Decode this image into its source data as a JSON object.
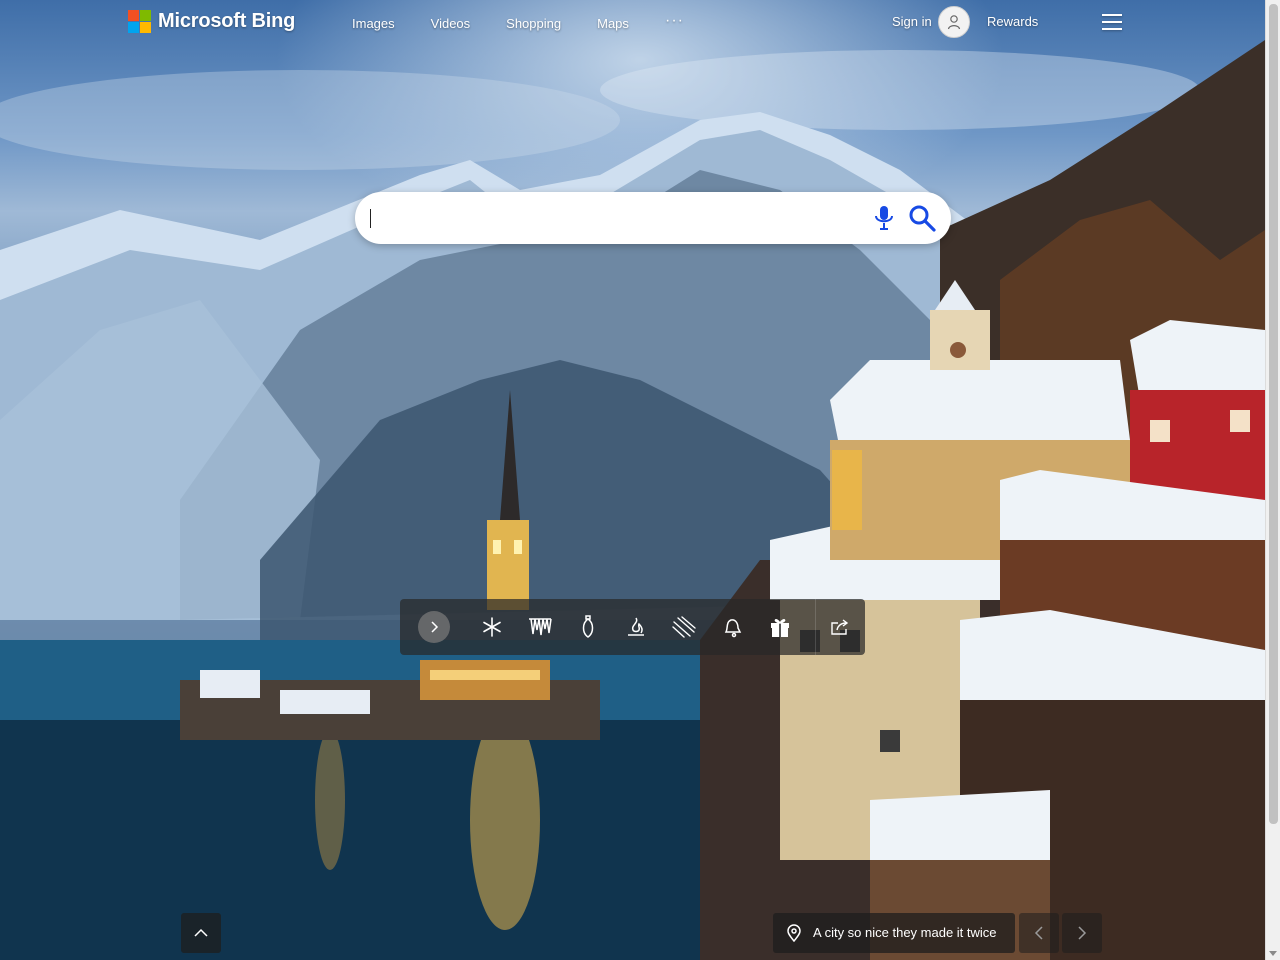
{
  "brand": {
    "name": "Microsoft Bing",
    "logo_colors": [
      "#f25022",
      "#7fba00",
      "#00a4ef",
      "#ffb900"
    ]
  },
  "nav": {
    "items": [
      {
        "label": "Images"
      },
      {
        "label": "Videos"
      },
      {
        "label": "Shopping"
      },
      {
        "label": "Maps"
      }
    ],
    "more_label": "···"
  },
  "account": {
    "signin_label": "Sign in",
    "rewards_label": "Rewards",
    "avatar_icon": "person-icon"
  },
  "search": {
    "value": "",
    "placeholder": "",
    "mic_icon": "microphone-icon",
    "submit_icon": "search-icon",
    "accent_color": "#174ae4"
  },
  "toolbar": {
    "items": [
      {
        "icon": "chevron-right-icon"
      },
      {
        "icon": "snowflake-icon"
      },
      {
        "icon": "icicles-icon"
      },
      {
        "icon": "ornament-icon"
      },
      {
        "icon": "fire-icon"
      },
      {
        "icon": "snowfall-icon"
      },
      {
        "icon": "bell-icon"
      },
      {
        "icon": "gift-icon"
      },
      {
        "icon": "share-icon"
      }
    ]
  },
  "footer": {
    "scroll_top_icon": "chevron-up-icon",
    "caption": "A city so nice they made it twice",
    "caption_icon": "location-pin-icon",
    "prev_icon": "chevron-left-icon",
    "next_icon": "chevron-right-icon"
  }
}
